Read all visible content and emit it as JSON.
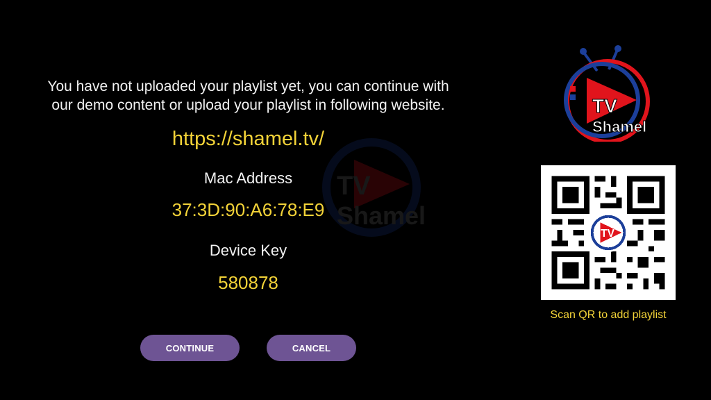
{
  "message": {
    "line1": "You have not uploaded your playlist yet, you can continue with",
    "line2": "our demo content or upload your playlist in following website."
  },
  "website_url": "https://shamel.tv/",
  "mac": {
    "label": "Mac Address",
    "value": "37:3D:90:A6:78:E9"
  },
  "device_key": {
    "label": "Device Key",
    "value": "580878"
  },
  "buttons": {
    "continue": "CONTINUE",
    "cancel": "CANCEL"
  },
  "logo": {
    "line1": "TV",
    "line2": "Shamel"
  },
  "qr": {
    "caption": "Scan QR to add playlist",
    "logo_text": "TV"
  },
  "colors": {
    "accent_yellow": "#f3d338",
    "button_purple": "#6e5494",
    "logo_red": "#e1141c",
    "logo_blue": "#1c3f9a"
  }
}
